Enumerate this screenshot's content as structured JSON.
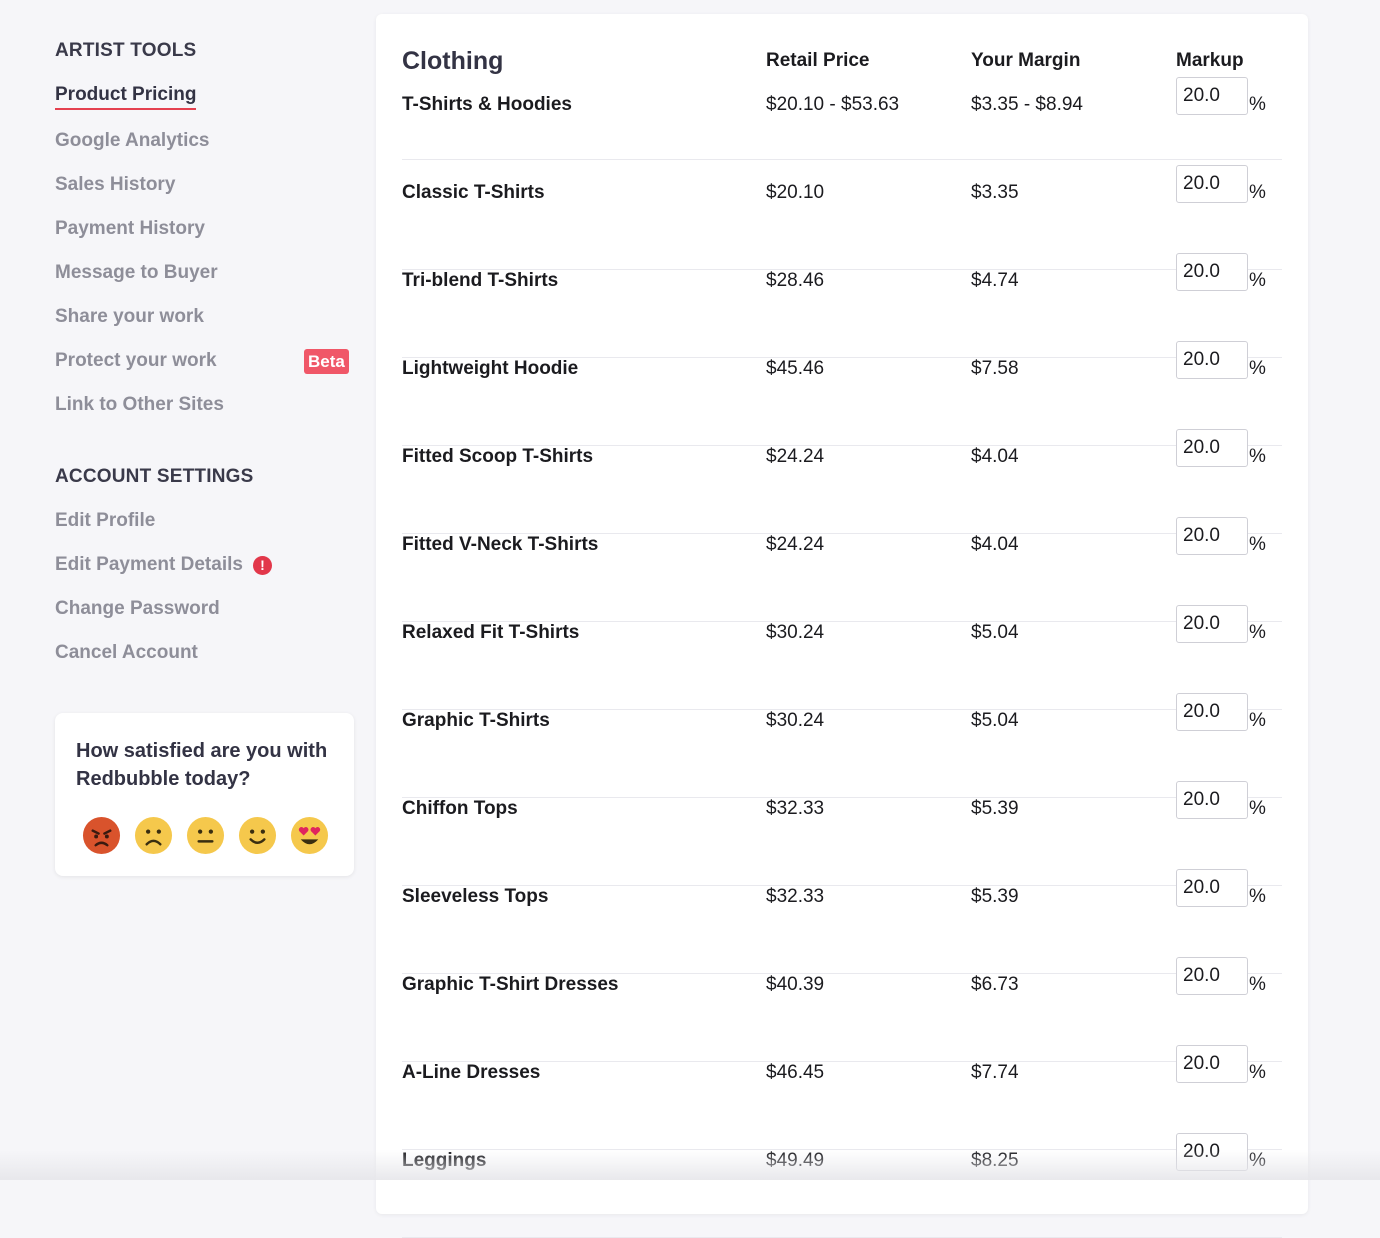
{
  "sidebar": {
    "artist_tools_title": "ARTIST TOOLS",
    "artist_tools": [
      {
        "label": "Product Pricing",
        "active": true
      },
      {
        "label": "Google Analytics"
      },
      {
        "label": "Sales History"
      },
      {
        "label": "Payment History"
      },
      {
        "label": "Message to Buyer"
      },
      {
        "label": "Share your work"
      },
      {
        "label": "Protect your work",
        "badge": "Beta"
      },
      {
        "label": "Link to Other Sites"
      }
    ],
    "account_settings_title": "ACCOUNT SETTINGS",
    "account_settings": [
      {
        "label": "Edit Profile"
      },
      {
        "label": "Edit Payment Details",
        "alert": "!"
      },
      {
        "label": "Change Password"
      },
      {
        "label": "Cancel Account"
      }
    ]
  },
  "survey": {
    "question": "How satisfied are you with Redbubble today?",
    "options": [
      "angry-face-icon",
      "frowning-face-icon",
      "neutral-face-icon",
      "slightly-smiling-face-icon",
      "heart-eyes-face-icon"
    ]
  },
  "table": {
    "category": "Clothing",
    "headers": {
      "retail": "Retail Price",
      "margin": "Your Margin",
      "markup": "Markup"
    },
    "percent_sign": "%",
    "rows": [
      {
        "name": "T-Shirts & Hoodies",
        "retail": "$20.10 - $53.63",
        "margin": "$3.35 - $8.94",
        "markup": "20.0"
      },
      {
        "name": "Classic T-Shirts",
        "retail": "$20.10",
        "margin": "$3.35",
        "markup": "20.0"
      },
      {
        "name": "Tri-blend T-Shirts",
        "retail": "$28.46",
        "margin": "$4.74",
        "markup": "20.0"
      },
      {
        "name": "Lightweight Hoodie",
        "retail": "$45.46",
        "margin": "$7.58",
        "markup": "20.0"
      },
      {
        "name": "Fitted Scoop T-Shirts",
        "retail": "$24.24",
        "margin": "$4.04",
        "markup": "20.0"
      },
      {
        "name": "Fitted V-Neck T-Shirts",
        "retail": "$24.24",
        "margin": "$4.04",
        "markup": "20.0"
      },
      {
        "name": "Relaxed Fit T-Shirts",
        "retail": "$30.24",
        "margin": "$5.04",
        "markup": "20.0"
      },
      {
        "name": "Graphic T-Shirts",
        "retail": "$30.24",
        "margin": "$5.04",
        "markup": "20.0"
      },
      {
        "name": "Chiffon Tops",
        "retail": "$32.33",
        "margin": "$5.39",
        "markup": "20.0"
      },
      {
        "name": "Sleeveless Tops",
        "retail": "$32.33",
        "margin": "$5.39",
        "markup": "20.0"
      },
      {
        "name": "Graphic T-Shirt Dresses",
        "retail": "$40.39",
        "margin": "$6.73",
        "markup": "20.0"
      },
      {
        "name": "A-Line Dresses",
        "retail": "$46.45",
        "margin": "$7.74",
        "markup": "20.0"
      },
      {
        "name": "Leggings",
        "retail": "$49.49",
        "margin": "$8.25",
        "markup": "20.0"
      }
    ]
  },
  "colors": {
    "accent": "#e4404f",
    "badge": "#f05768",
    "alert": "#e2374a"
  }
}
